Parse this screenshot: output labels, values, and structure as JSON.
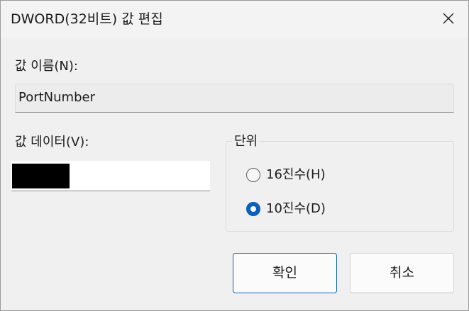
{
  "window": {
    "title": "DWORD(32비트) 값 편집",
    "close_icon": "close-icon"
  },
  "value_name": {
    "label": "값 이름(N):",
    "value": "PortNumber"
  },
  "value_data": {
    "label": "값 데이터(V):",
    "redacted": true
  },
  "base": {
    "legend": "단위",
    "options": [
      {
        "label": "16진수(H)",
        "selected": false
      },
      {
        "label": "10진수(D)",
        "selected": true
      }
    ]
  },
  "buttons": {
    "ok_label": "확인",
    "cancel_label": "취소"
  },
  "colors": {
    "accent": "#0a5fbf",
    "background": "#f0f0f0"
  }
}
